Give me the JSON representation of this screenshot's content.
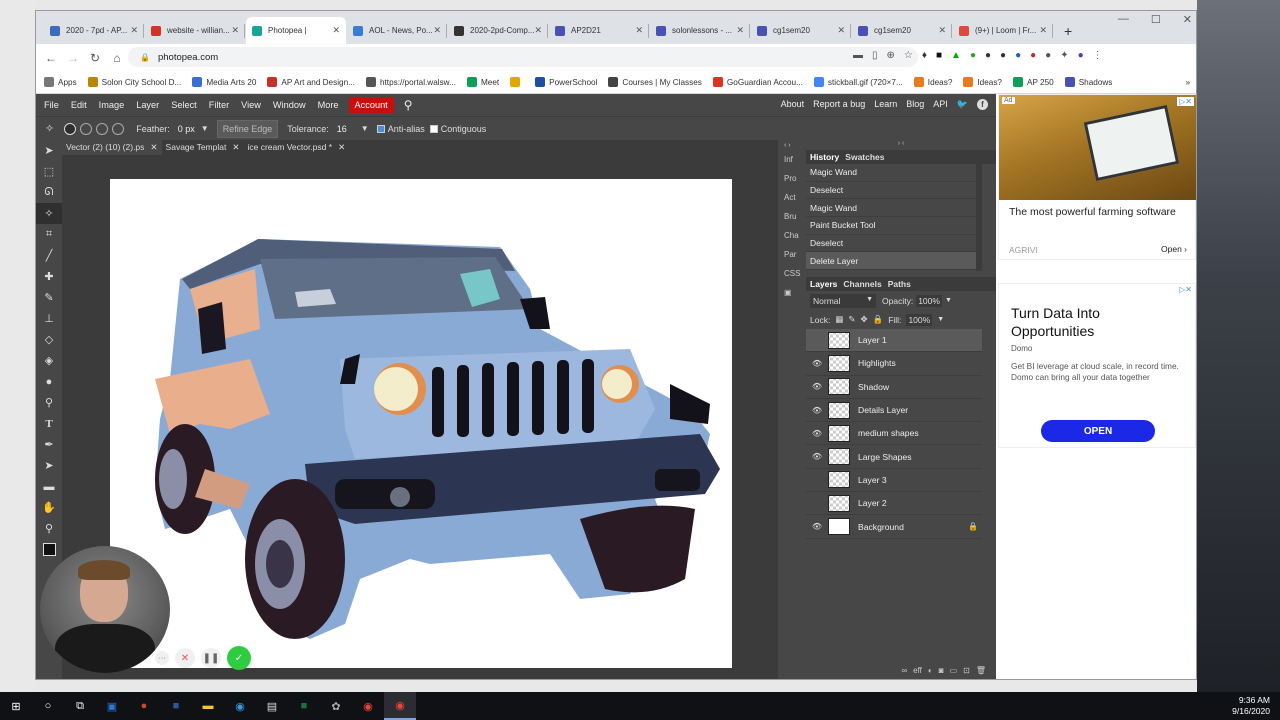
{
  "browser": {
    "tabs": [
      {
        "title": "2020 - 7pd - AP...",
        "color": "#3b6bbd"
      },
      {
        "title": "website - willian...",
        "color": "#d93025"
      },
      {
        "title": "Photopea |",
        "color": "#18a497",
        "active": true
      },
      {
        "title": "AOL - News, Po...",
        "color": "#3a7bd5"
      },
      {
        "title": "2020-2pd-Comp...",
        "color": "#333"
      },
      {
        "title": "AP2D21",
        "color": "#4a51b4"
      },
      {
        "title": "solonlessons - ...",
        "color": "#4a51b4"
      },
      {
        "title": "cg1sem20",
        "color": "#4a51b4"
      },
      {
        "title": "cg1sem20",
        "color": "#4a51b4"
      },
      {
        "title": "(9+) | Loom | Fr...",
        "color": "#e3463d"
      }
    ],
    "new_tab": "+",
    "url": "photopea.com",
    "bookmarks": [
      {
        "label": "Apps",
        "color": "#777"
      },
      {
        "label": "Solon City School D...",
        "color": "#b8860b"
      },
      {
        "label": "Media Arts 20",
        "color": "#3a6fcf"
      },
      {
        "label": "AP Art and Design...",
        "color": "#c9302c"
      },
      {
        "label": "https://portal.walsw...",
        "color": "#555"
      },
      {
        "label": "Meet",
        "color": "#0f9d58"
      },
      {
        "label": "",
        "color": "#e0a800"
      },
      {
        "label": "PowerSchool",
        "color": "#1c4fa1"
      },
      {
        "label": "Courses | My Classes",
        "color": "#444"
      },
      {
        "label": "GoGuardian Accou...",
        "color": "#d32"
      },
      {
        "label": "stickball.gif (720×7...",
        "color": "#4285f4"
      },
      {
        "label": "Ideas?",
        "color": "#e77b1e"
      },
      {
        "label": "Ideas?",
        "color": "#e77b1e"
      },
      {
        "label": "AP 250",
        "color": "#0f9d58"
      },
      {
        "label": "Shadows",
        "color": "#4a51b4"
      }
    ],
    "more": "»"
  },
  "photopea": {
    "menu": [
      "File",
      "Edit",
      "Image",
      "Layer",
      "Select",
      "Filter",
      "View",
      "Window",
      "More"
    ],
    "account": "Account",
    "menu_right": [
      "About",
      "Report a bug",
      "Learn",
      "Blog",
      "API"
    ],
    "options": {
      "feather_label": "Feather:",
      "feather_value": "0 px",
      "refine": "Refine Edge",
      "tolerance_label": "Tolerance:",
      "tolerance_value": "16",
      "antialias": "Anti-alias",
      "contiguous": "Contiguous"
    },
    "doc_tabs": [
      "Vector (2) (10) (2).ps",
      "Savage Templat",
      "ice cream Vector.psd *"
    ],
    "mini_panels": [
      "Inf",
      "Pro",
      "Act",
      "Bru",
      "Cha",
      "Par",
      "CSS"
    ],
    "history_tabs": [
      "History",
      "Swatches"
    ],
    "history": [
      "Magic Wand",
      "Deselect",
      "Magic Wand",
      "Paint Bucket Tool",
      "Deselect",
      "Delete Layer"
    ],
    "layer_tabs": [
      "Layers",
      "Channels",
      "Paths"
    ],
    "blend_mode": "Normal",
    "opacity_label": "Opacity:",
    "opacity_value": "100%",
    "lock_label": "Lock:",
    "fill_label": "Fill:",
    "fill_value": "100%",
    "layers": [
      {
        "name": "Layer 1",
        "visible": false,
        "selected": true
      },
      {
        "name": "Highlights",
        "visible": true
      },
      {
        "name": "Shadow",
        "visible": true
      },
      {
        "name": "Details Layer",
        "visible": true
      },
      {
        "name": "medium shapes",
        "visible": true
      },
      {
        "name": "Large Shapes",
        "visible": true
      },
      {
        "name": "Layer 3",
        "visible": false
      },
      {
        "name": "Layer 2",
        "visible": false
      },
      {
        "name": "Background",
        "visible": true,
        "locked": true
      }
    ]
  },
  "ads": {
    "ad1": {
      "badge": "Ad",
      "headline": "The most powerful farming software",
      "advertiser": "AGRIVI",
      "cta": "Open"
    },
    "ad2": {
      "headline": "Turn Data Into Opportunities",
      "advertiser": "Domo",
      "body": "Get BI leverage at cloud scale, in record time. Domo can bring all your data together",
      "cta": "OPEN"
    }
  },
  "taskbar": {
    "time": "9:36 AM",
    "date": "9/16/2020"
  }
}
